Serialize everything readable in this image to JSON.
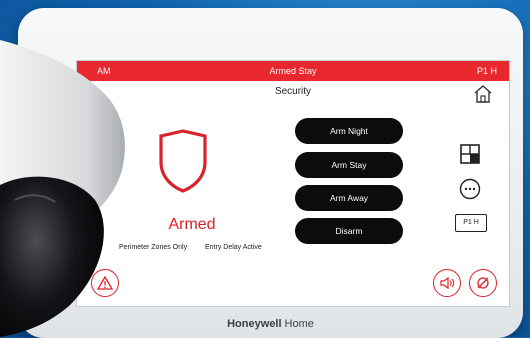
{
  "status_bar": {
    "time": "AM",
    "mode": "Armed Stay",
    "partition": "P1 H"
  },
  "header": {
    "title": "Security",
    "home_icon": "home-icon"
  },
  "panel": {
    "state_label": "Armed",
    "zones_text": "Perimeter Zones Only",
    "delay_text": "Entry Delay Active",
    "shield_icon": "shield-icon"
  },
  "buttons": {
    "arm_night": "Arm Night",
    "arm_stay": "Arm Stay",
    "arm_away": "Arm Away",
    "disarm": "Disarm"
  },
  "side_icons": {
    "partitions": "partitions-icon",
    "more": "more-icon",
    "partition_label": "P1 H"
  },
  "footer": {
    "alert_icon": "alert-icon",
    "volume_icon": "volume-icon",
    "bypass_icon": "bypass-icon"
  },
  "brand": {
    "name_bold": "Honeywell",
    "name_light": " Home"
  },
  "colors": {
    "accent": "#e8282e",
    "button": "#0c0c0c",
    "background": "#1166b3"
  }
}
